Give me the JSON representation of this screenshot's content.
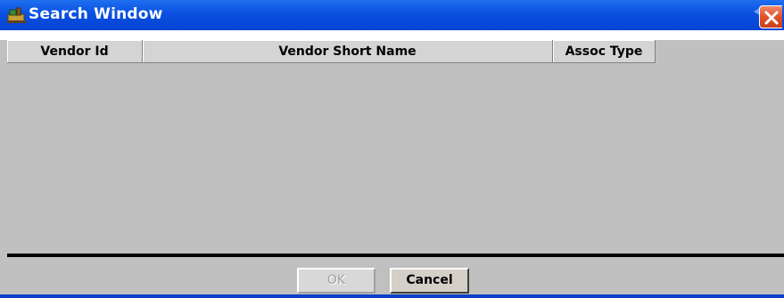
{
  "window": {
    "title": "Search Window",
    "icon": "app-icon",
    "close_icon": "close-icon",
    "titlebar_color": "#0a50e0",
    "close_color": "#e0512a"
  },
  "grid": {
    "columns": [
      {
        "label": "Vendor Id"
      },
      {
        "label": "Vendor Short Name"
      },
      {
        "label": "Assoc Type"
      }
    ],
    "rows": []
  },
  "buttons": {
    "ok_label": "OK",
    "ok_enabled": false,
    "cancel_label": "Cancel"
  }
}
